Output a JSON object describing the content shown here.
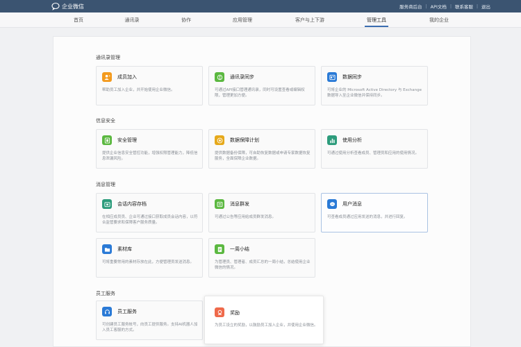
{
  "topbar": {
    "app_name": "企业微信",
    "links": [
      "服务商后台",
      "API文档",
      "联系客服",
      "退出"
    ]
  },
  "nav": {
    "items": [
      {
        "label": "首页"
      },
      {
        "label": "通讯录"
      },
      {
        "label": "协作"
      },
      {
        "label": "应用管理"
      },
      {
        "label": "客户与上下游"
      },
      {
        "label": "管理工具",
        "active": true
      },
      {
        "label": "我的企业"
      }
    ]
  },
  "sections": [
    {
      "title": "通讯录管理",
      "cards": [
        {
          "title": "成员加入",
          "desc": "帮助员工加入企业，并开始使用企业微信。",
          "icon": "user-add-icon",
          "color": "#f39a1e"
        },
        {
          "title": "通讯录同步",
          "desc": "可通过API接口管理通讯录，同时可设置查看或编辑权限，管理更加方便。",
          "icon": "sync-icon",
          "color": "#5bb840"
        },
        {
          "title": "数据同步",
          "desc": "可将企业的 Microsoft Active Directory 与 Exchange 数据导入至企业微信并保持同步。",
          "icon": "data-sync-icon",
          "color": "#2a7ad6"
        }
      ]
    },
    {
      "title": "信息安全",
      "cards": [
        {
          "title": "安全管理",
          "desc": "提供企业信息安全管控功能，增强权限管理能力，降低信息泄漏风险。",
          "icon": "shield-icon",
          "color": "#5bb840"
        },
        {
          "title": "数据保障计划",
          "desc": "提供数据备份保障，可自助恢复数据或申请专家数据恢复服务，全面保障企业数据。",
          "icon": "lifebuoy-icon",
          "color": "#e6a91b"
        },
        {
          "title": "使用分析",
          "desc": "可通过使用分析查看成员、管理员和应用的使用情况。",
          "icon": "bar-chart-icon",
          "color": "#2d9c7c"
        }
      ]
    },
    {
      "title": "消息管理",
      "cards": [
        {
          "title": "会话内容存档",
          "desc": "在相应成员员、企业可通过接口获取成员会话内容，以符合监管要求和保障客户服务质量。",
          "icon": "archive-icon",
          "color": "#2d9c7c"
        },
        {
          "title": "消息群发",
          "desc": "可通过公告等应用给成员群发消息。",
          "icon": "broadcast-icon",
          "color": "#5bb840"
        },
        {
          "title": "用户消息",
          "desc": "可查看成员通过应用发送的消息，并进行回复。",
          "icon": "chat-icon",
          "color": "#2a7ad6"
        },
        {
          "title": "素材库",
          "desc": "可将重要常用的素材存放在此，方便管理员发送消息。",
          "icon": "folder-icon",
          "color": "#2a7ad6"
        },
        {
          "title": "一周小结",
          "desc": "为管理员、管理者、成员汇总的一周小结，总结使用企业微信的情况。",
          "icon": "doc-icon",
          "color": "#5bb840"
        }
      ]
    },
    {
      "title": "员工服务",
      "cards": [
        {
          "title": "员工服务",
          "desc": "可创建员工服务帐号，向员工提供服务。支持AI机器人加入员工客服的方式。",
          "icon": "headset-icon",
          "color": "#2a7ad6"
        },
        {
          "title": "奖励",
          "desc": "为员工设立的奖励，以鼓励员工加入企业，并使用企业微信。",
          "icon": "award-icon",
          "color": "#ef6a4b"
        }
      ]
    }
  ]
}
